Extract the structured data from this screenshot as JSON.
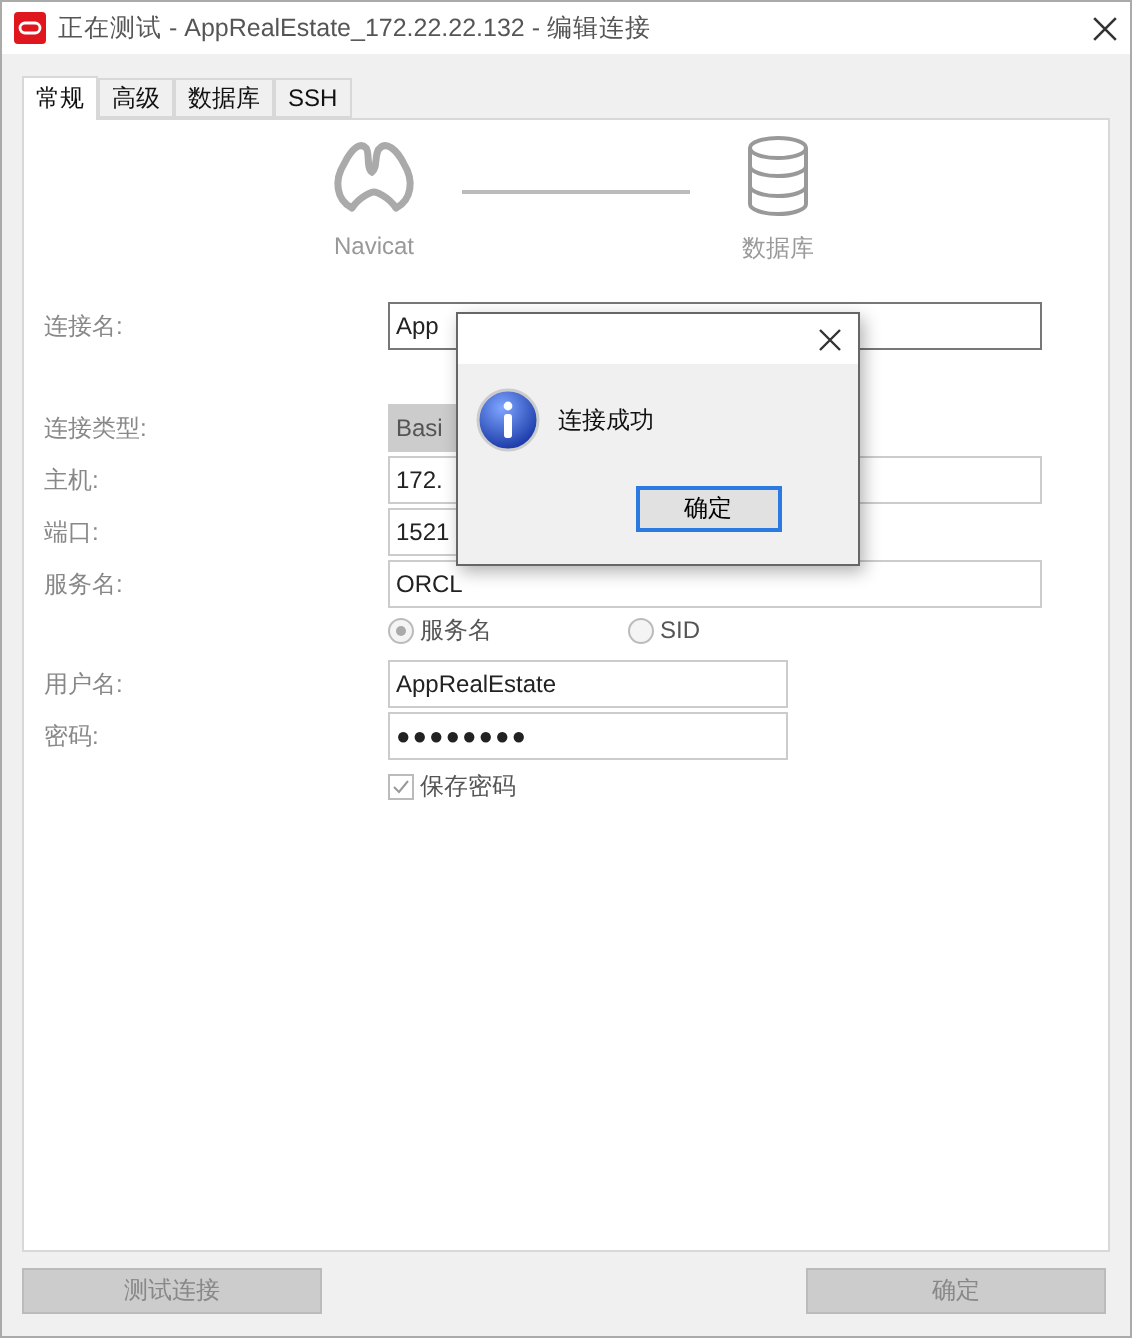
{
  "window": {
    "title": "正在测试 - AppRealEstate_172.22.22.132 - 编辑连接"
  },
  "tabs": [
    {
      "label": "常规",
      "selected": true
    },
    {
      "label": "高级",
      "selected": false
    },
    {
      "label": "数据库",
      "selected": false
    },
    {
      "label": "SSH",
      "selected": false
    }
  ],
  "diagram": {
    "left_label": "Navicat",
    "right_label": "数据库"
  },
  "general": [
    {
      "kind": "text",
      "label": "连接名:",
      "value": "App"
    }
  ],
  "server": [
    {
      "kind": "select",
      "label": "连接类型:",
      "value": "Basi"
    },
    {
      "kind": "text",
      "label": "主机:",
      "value": "172."
    },
    {
      "kind": "short",
      "label": "端口:",
      "value": "1521"
    },
    {
      "kind": "text",
      "label": "服务名:",
      "value": "ORCL"
    }
  ],
  "service_type": [
    {
      "label": "服务名",
      "selected": true
    },
    {
      "label": "SID",
      "selected": false
    }
  ],
  "auth": [
    {
      "kind": "short",
      "label": "用户名:",
      "value": "AppRealEstate"
    },
    {
      "kind": "password",
      "label": "密码:",
      "value": "●●●●●●●●"
    }
  ],
  "save_password": {
    "label": "保存密码",
    "checked": true
  },
  "buttons": [
    {
      "label": "测试连接",
      "disabled": true
    },
    {
      "label": "确定",
      "disabled": true
    }
  ],
  "dialog": {
    "message": "连接成功",
    "button": "确定"
  }
}
